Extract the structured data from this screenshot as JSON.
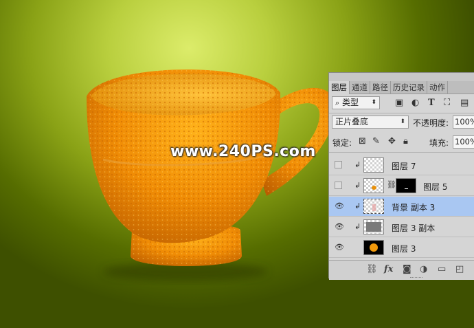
{
  "watermark": "www.240PS.com",
  "layers_panel": {
    "tabs": [
      "图层",
      "通道",
      "路径",
      "历史记录",
      "动作"
    ],
    "filter": {
      "label": "类型"
    },
    "blend_mode": "正片叠底",
    "opacity_label": "不透明度:",
    "opacity_value": "100%",
    "lock_label": "锁定:",
    "fill_label": "填充:",
    "fill_value": "100%",
    "layers": [
      {
        "name": "图层 7",
        "visible": false,
        "clipped": true,
        "selected": false
      },
      {
        "name": "图层 5",
        "visible": false,
        "clipped": true,
        "selected": false,
        "has_mask": true
      },
      {
        "name": "背景 副本 3",
        "visible": true,
        "clipped": true,
        "selected": true
      },
      {
        "name": "图层 3 副本",
        "visible": true,
        "clipped": true,
        "selected": false
      },
      {
        "name": "图层 3",
        "visible": true,
        "clipped": false,
        "selected": false
      }
    ],
    "bottom_icons": [
      "link-icon",
      "fx-icon",
      "mask-icon",
      "adjustment-icon",
      "folder-icon",
      "new-layer-icon"
    ],
    "fx_label": "fx"
  },
  "colors": {
    "panel_bg": "#d5d5d5",
    "selected_layer": "#a9c7f2",
    "background_green": "#8aa216",
    "cup_orange": "#e8900a"
  }
}
